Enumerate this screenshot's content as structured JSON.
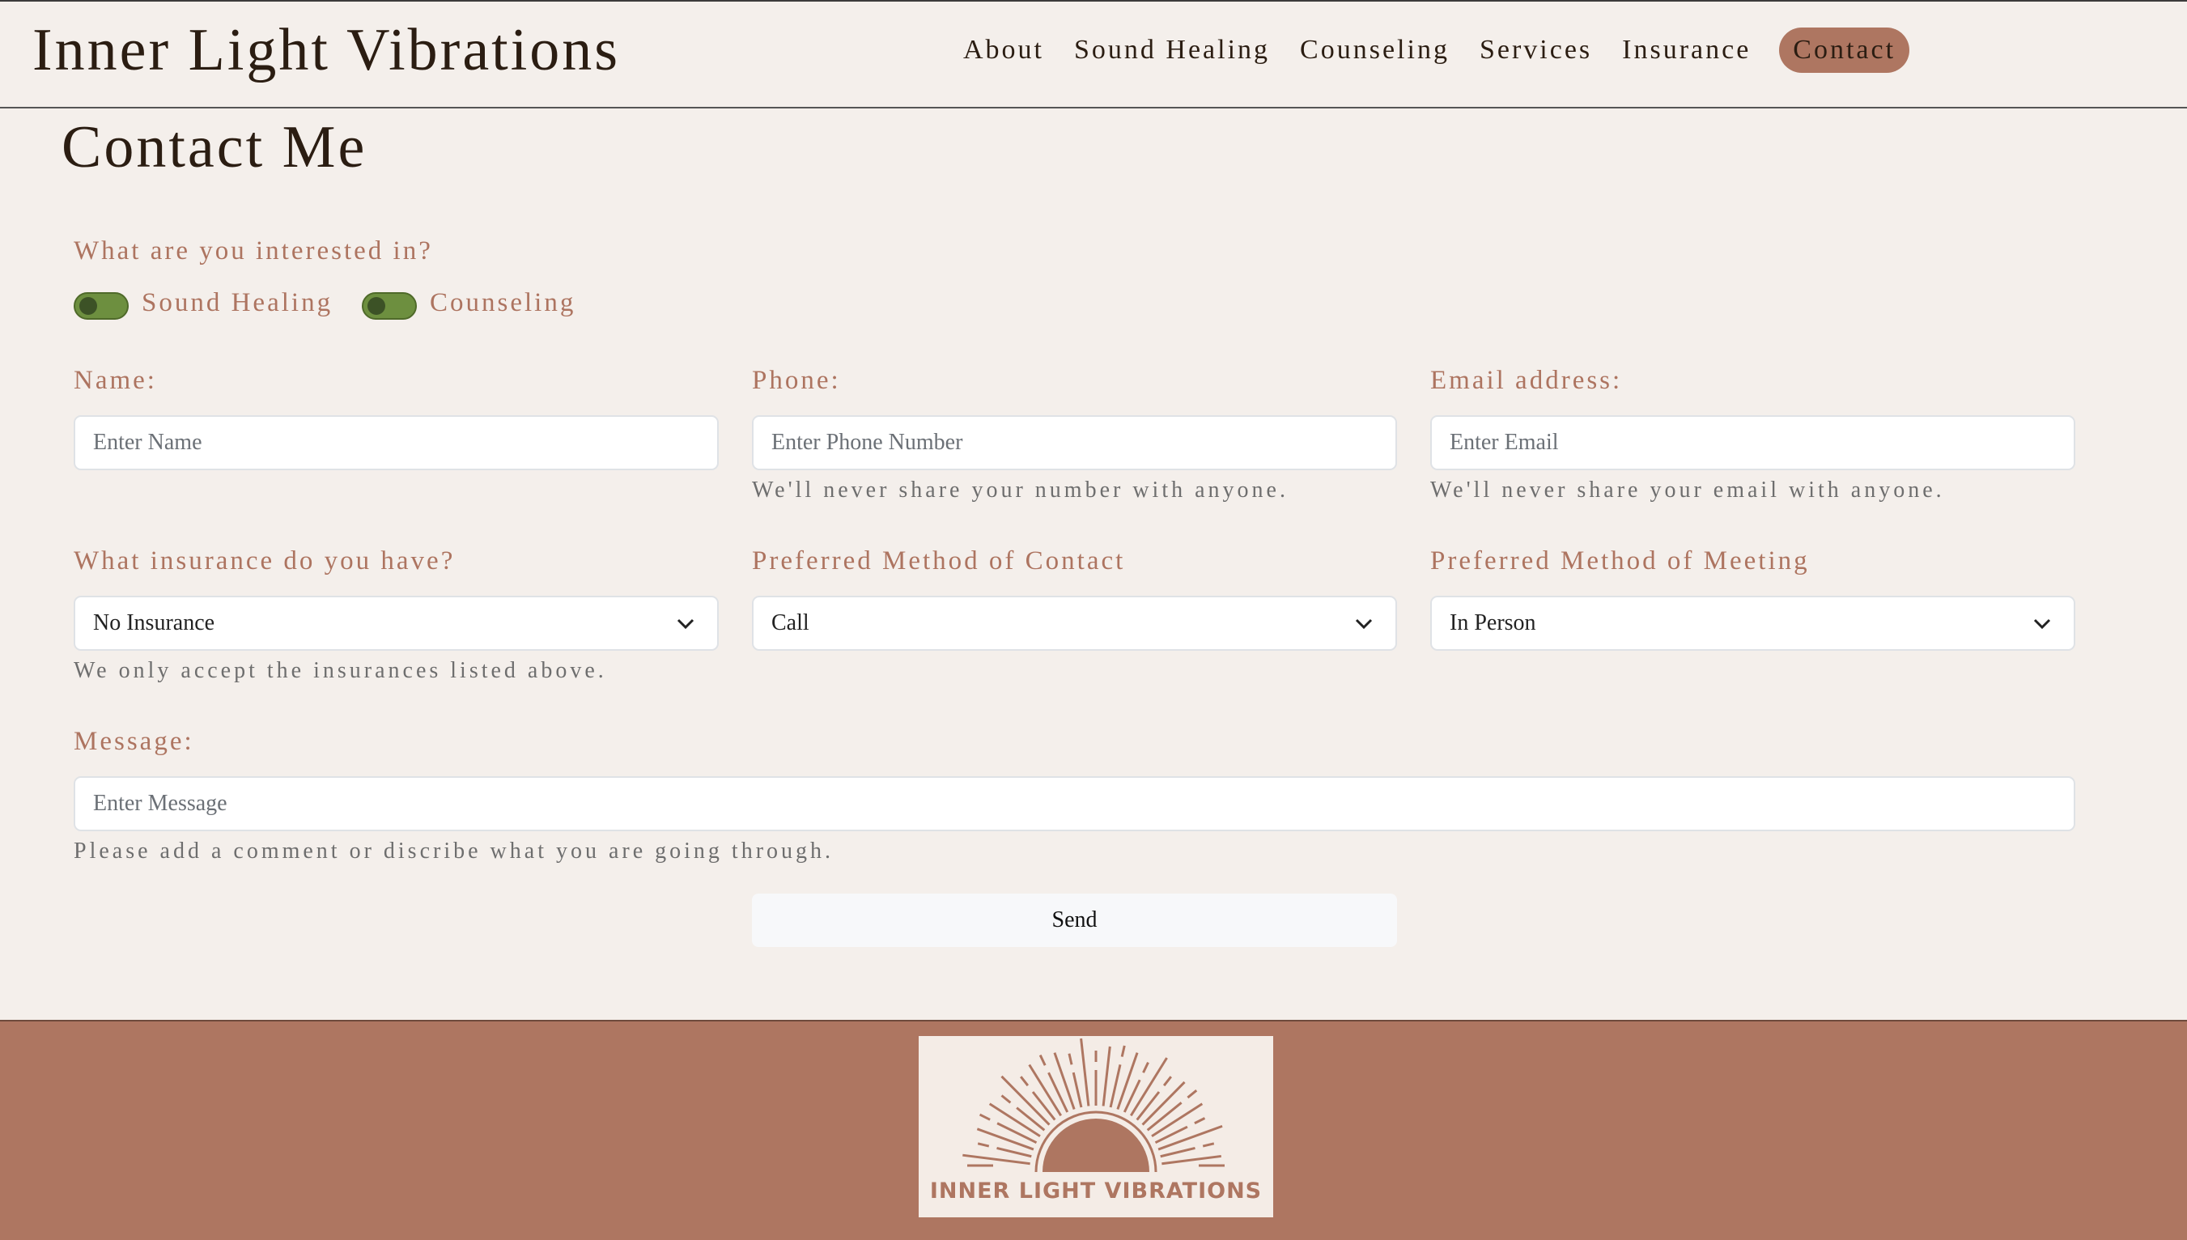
{
  "header": {
    "brand": "Inner Light Vibrations",
    "nav": [
      "About",
      "Sound Healing",
      "Counseling",
      "Services",
      "Insurance",
      "Contact"
    ],
    "active_nav": "Contact"
  },
  "page_title": "Contact Me",
  "interest": {
    "label": "What are you interested in?",
    "options": [
      "Sound Healing",
      "Counseling"
    ]
  },
  "fields": {
    "name": {
      "label": "Name:",
      "placeholder": "Enter Name"
    },
    "phone": {
      "label": "Phone:",
      "placeholder": "Enter Phone Number",
      "help": "We'll never share your number with anyone."
    },
    "email": {
      "label": "Email address:",
      "placeholder": "Enter Email",
      "help": "We'll never share your email with anyone."
    },
    "insurance": {
      "label": "What insurance do you have?",
      "value": "No Insurance",
      "help": "We only accept the insurances listed above."
    },
    "contact_method": {
      "label": "Preferred Method of Contact",
      "value": "Call"
    },
    "meeting_method": {
      "label": "Preferred Method of Meeting",
      "value": "In Person"
    },
    "message": {
      "label": "Message:",
      "placeholder": "Enter Message",
      "help": "Please add a comment or discribe what you are going through."
    }
  },
  "send_label": "Send",
  "footer": {
    "logo_text": "INNER LIGHT VIBRATIONS"
  },
  "colors": {
    "accent": "#ae7661",
    "background": "#f4efeb",
    "toggle": "#6d8f3f",
    "text": "#2b1d12"
  },
  "icons": [
    "chevron-down-icon",
    "sunburst-logo-icon"
  ]
}
